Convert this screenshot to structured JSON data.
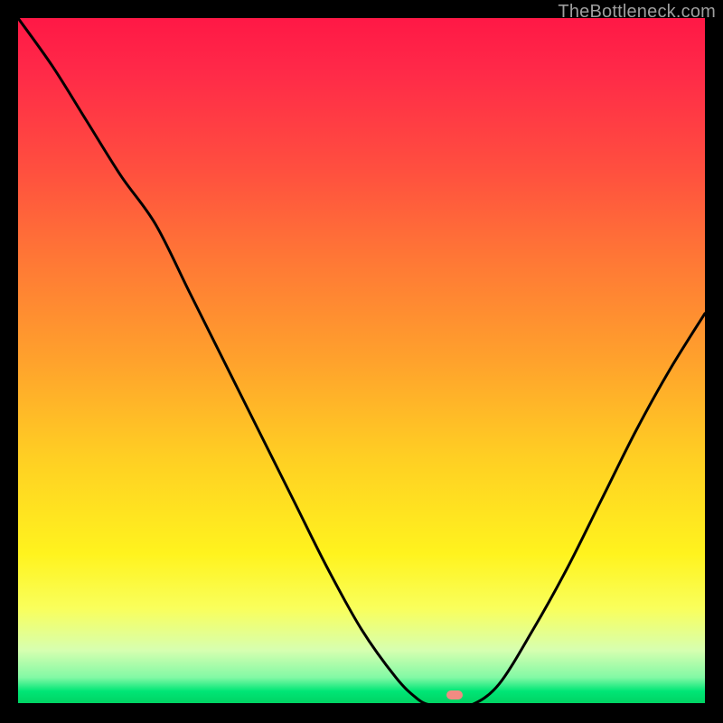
{
  "watermark": "TheBottleneck.com",
  "marker": {
    "x_fraction": 0.635,
    "y_fraction": 0.985,
    "color": "#f28b82"
  },
  "chart_data": {
    "type": "line",
    "title": "",
    "xlabel": "",
    "ylabel": "",
    "xlim": [
      0,
      1
    ],
    "ylim": [
      0,
      1
    ],
    "background": "red-yellow-green vertical gradient",
    "series": [
      {
        "name": "bottleneck-curve",
        "x": [
          0.0,
          0.05,
          0.1,
          0.15,
          0.2,
          0.25,
          0.3,
          0.35,
          0.4,
          0.45,
          0.5,
          0.55,
          0.58,
          0.6,
          0.63,
          0.66,
          0.7,
          0.75,
          0.8,
          0.85,
          0.9,
          0.95,
          1.0
        ],
        "y": [
          1.0,
          0.93,
          0.85,
          0.77,
          0.7,
          0.6,
          0.5,
          0.4,
          0.3,
          0.2,
          0.11,
          0.04,
          0.01,
          0.0,
          0.0,
          0.0,
          0.03,
          0.11,
          0.2,
          0.3,
          0.4,
          0.49,
          0.57
        ]
      }
    ],
    "annotations": [
      {
        "type": "marker",
        "x": 0.635,
        "y": 0.0,
        "label": "optimal-point"
      }
    ]
  }
}
